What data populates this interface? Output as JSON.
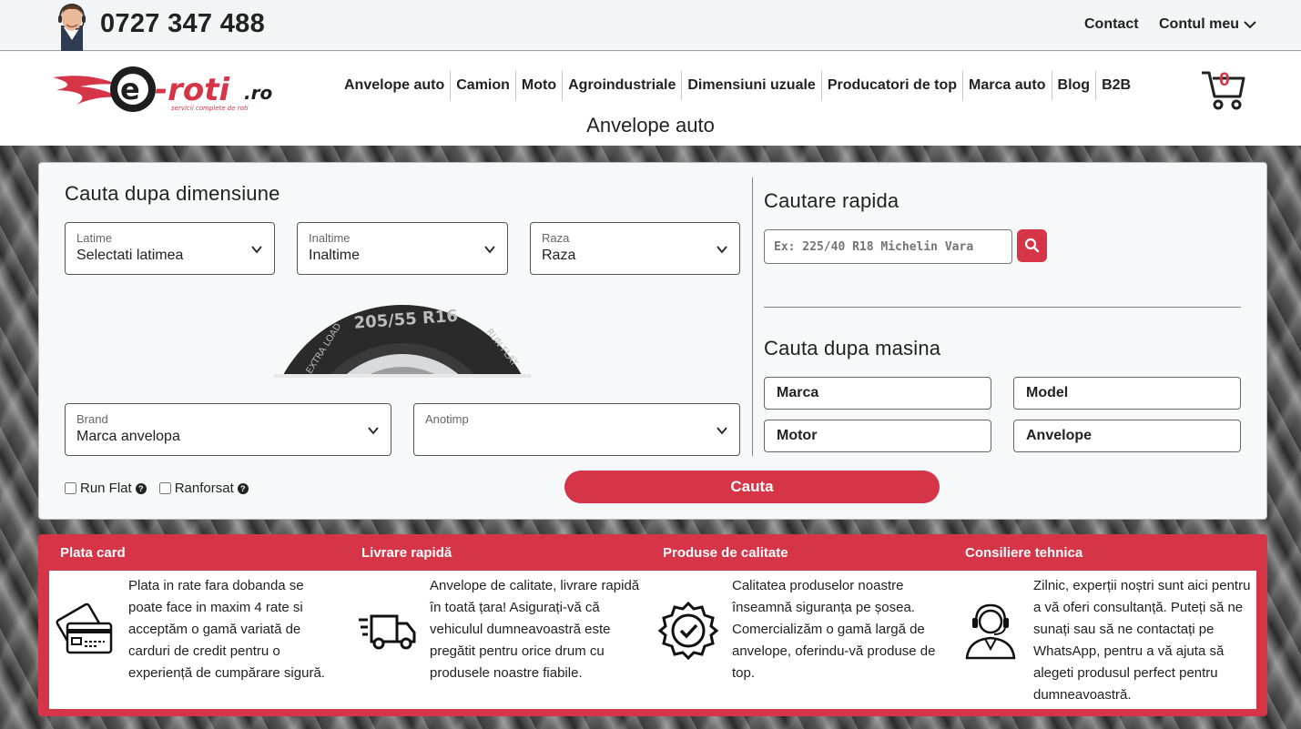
{
  "topbar": {
    "phone": "0727 347 488",
    "contact": "Contact",
    "account": "Contul meu"
  },
  "header": {
    "logo_text": "e-roti.ro",
    "logo_tagline": "servicii complete de roti",
    "nav": [
      "Anvelope auto",
      "Camion",
      "Moto",
      "Agroindustriale",
      "Dimensiuni uzuale",
      "Producatori de top",
      "Marca auto",
      "Blog",
      "B2B"
    ],
    "cart_count": "0",
    "page_title": "Anvelope auto"
  },
  "search": {
    "title": "Cauta dupa dimensiune",
    "latime": {
      "label": "Latime",
      "value": "Selectati latimea"
    },
    "inaltime": {
      "label": "Inaltime",
      "value": "Inaltime"
    },
    "raza": {
      "label": "Raza",
      "value": "Raza"
    },
    "brand": {
      "label": "Brand",
      "value": "Marca anvelopa"
    },
    "anotimp": {
      "label": "Anotimp",
      "value": ""
    },
    "tyre_text": "205/55 R16",
    "tyre_side_left": "EXTRA LOAD",
    "tyre_side_right": "RUN FLAT",
    "runflat": "Run Flat",
    "ranforsat": "Ranforsat",
    "help": "?",
    "button": "Cauta"
  },
  "quick": {
    "title": "Cautare rapida",
    "placeholder": "Ex: 225/40 R18 Michelin Vara"
  },
  "car": {
    "title": "Cauta dupa masina",
    "marca": "Marca",
    "model": "Model",
    "motor": "Motor",
    "anvelope": "Anvelope"
  },
  "features": [
    {
      "title": "Plata card",
      "text": "Plata in rate fara dobanda se poate face in maxim 4 rate si acceptăm o gamă variată de carduri de credit pentru o experiență de cumpărare sigură.",
      "icon": "credit-card-icon"
    },
    {
      "title": "Livrare rapidă",
      "text": "Anvelope de calitate, livrare rapidă în toată țara! Asigurați-vă că vehiculul dumneavoastră este pregătit pentru orice drum cu produsele noastre fiabile.",
      "icon": "delivery-truck-icon"
    },
    {
      "title": "Produse de calitate",
      "text": "Calitatea produselor noastre înseamnă siguranța pe șosea. Comercializăm o gamă largă de anvelope, oferindu-vă produse de top.",
      "icon": "quality-badge-icon"
    },
    {
      "title": "Consiliere tehnica",
      "text": "Zilnic, experții noștri sunt aici pentru a vă oferi consultanță. Puteți să ne sunați sau să ne contactați pe WhatsApp, pentru a vă ajuta să alegeti produsul perfect pentru dumneavoastră.",
      "icon": "support-agent-icon"
    }
  ],
  "colors": {
    "accent": "#d63447",
    "text": "#222222",
    "panel": "#f7f8fa"
  }
}
